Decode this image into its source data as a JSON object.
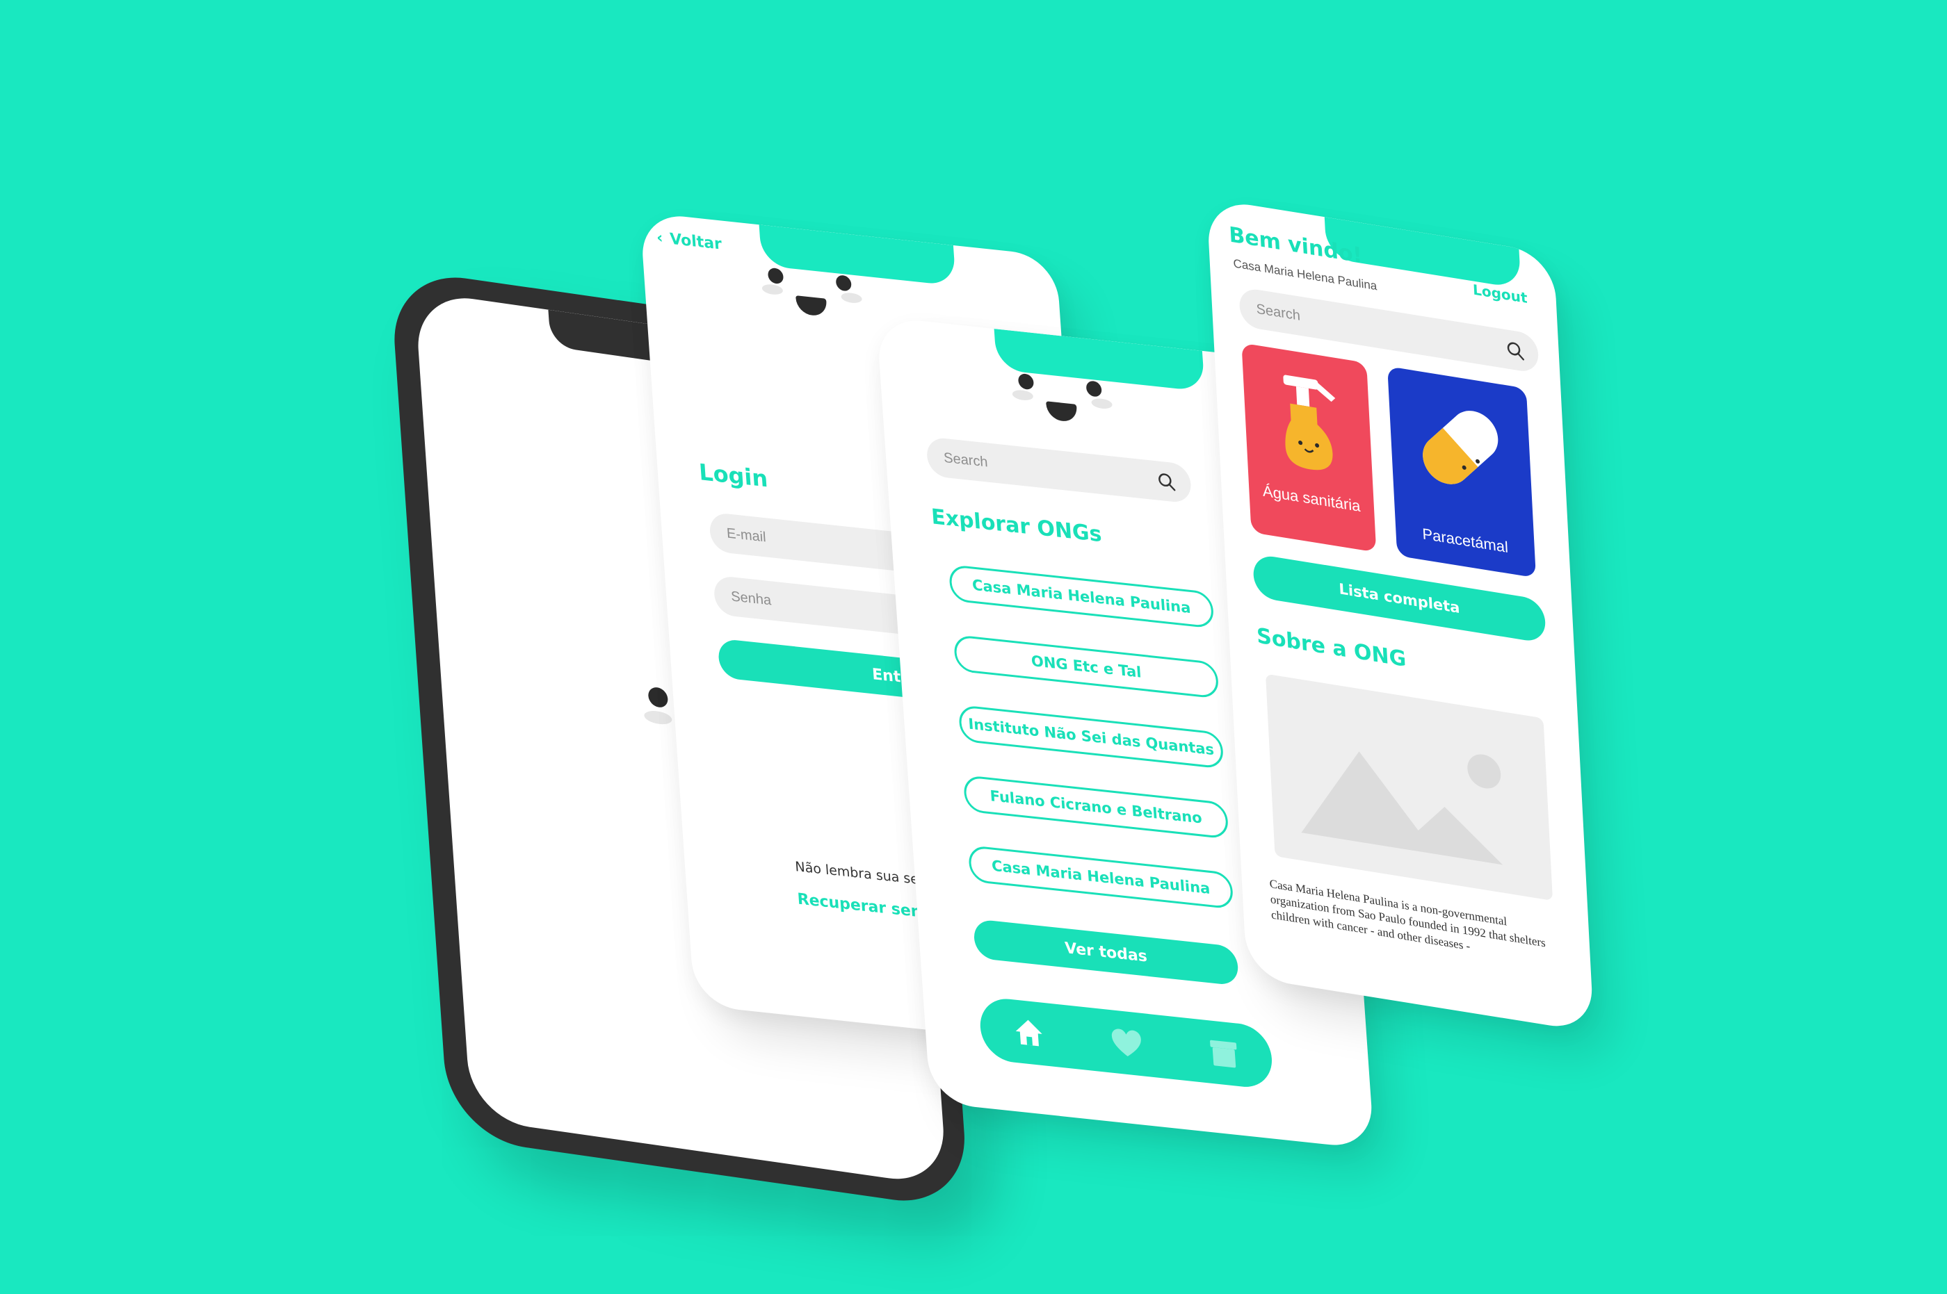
{
  "colors": {
    "background": "#19E8C0",
    "accent": "#19E0B8",
    "card_red": "#F0495C",
    "card_blue": "#1B3BC8"
  },
  "login": {
    "back_label": "Voltar",
    "title": "Login",
    "email_placeholder": "E-mail",
    "password_placeholder": "Senha",
    "submit_label": "Entrar",
    "forgot_prompt": "Não lembra sua senha?",
    "recover_label": "Recuperar senha"
  },
  "explore": {
    "search_placeholder": "Search",
    "title": "Explorar ONGs",
    "ongs": [
      {
        "name": "Casa Maria Helena Paulina"
      },
      {
        "name": "ONG Etc e Tal"
      },
      {
        "name": "Instituto Não Sei das Quantas"
      },
      {
        "name": "Fulano Cicrano e Beltrano"
      },
      {
        "name": "Casa Maria Helena Paulina"
      }
    ],
    "see_all_label": "Ver todas",
    "nav": [
      "home-icon",
      "heart-icon",
      "box-icon"
    ]
  },
  "dashboard": {
    "welcome": "Bem vindo!",
    "org_name": "Casa Maria Helena Paulina",
    "logout_label": "Logout",
    "search_placeholder": "Search",
    "items": [
      {
        "label": "Água sanitária",
        "icon": "spray-bottle-icon"
      },
      {
        "label": "Paracetámal",
        "icon": "pill-icon"
      }
    ],
    "full_list_label": "Lista completa",
    "about_title": "Sobre a ONG",
    "about_text": "Casa Maria Helena Paulina is a non-governmental organization from Sao Paulo founded in 1992 that shelters children with cancer - and other diseases -"
  }
}
